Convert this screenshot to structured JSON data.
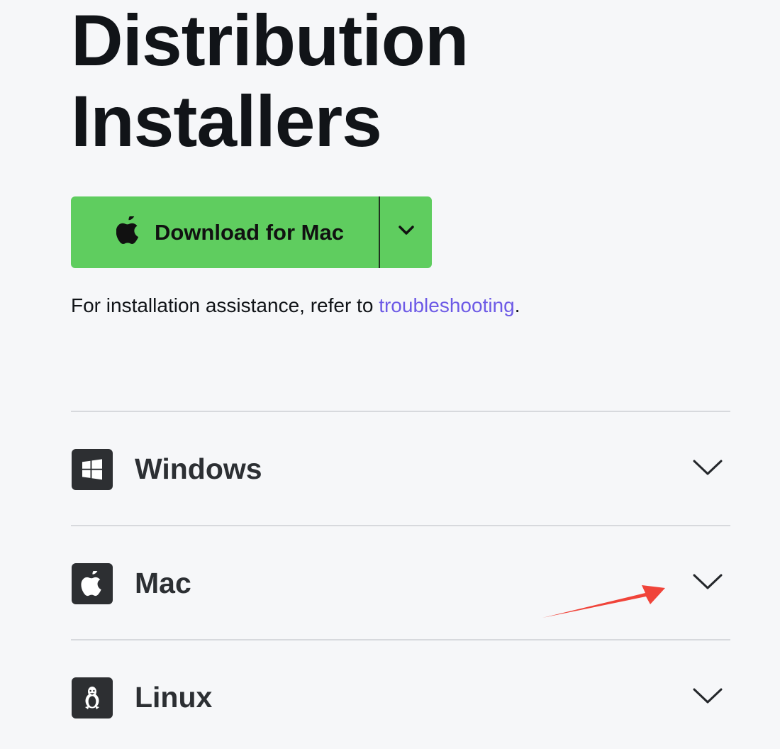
{
  "title": {
    "line1": "Distribution",
    "line2": "Installers"
  },
  "download": {
    "label": "Download for Mac",
    "icon": "apple-icon",
    "toggle_icon": "chevron-down-icon",
    "color": "#5fcd5f"
  },
  "help": {
    "prefix": "For installation assistance, refer to ",
    "link": "troubleshooting",
    "suffix": ".",
    "link_color": "#6d5ae6"
  },
  "platforms": [
    {
      "label": "Windows",
      "icon": "windows-icon",
      "chevron_icon": "chevron-down-icon"
    },
    {
      "label": "Mac",
      "icon": "apple-icon",
      "chevron_icon": "chevron-down-icon"
    },
    {
      "label": "Linux",
      "icon": "linux-icon",
      "chevron_icon": "chevron-down-icon"
    }
  ],
  "annotation": {
    "type": "red-arrow",
    "target": "Mac chevron",
    "color": "#f0443a"
  },
  "colors": {
    "background": "#f6f7f9",
    "text": "#111418",
    "divider": "#d7d9dd",
    "icon_tile": "#2d2f32"
  }
}
